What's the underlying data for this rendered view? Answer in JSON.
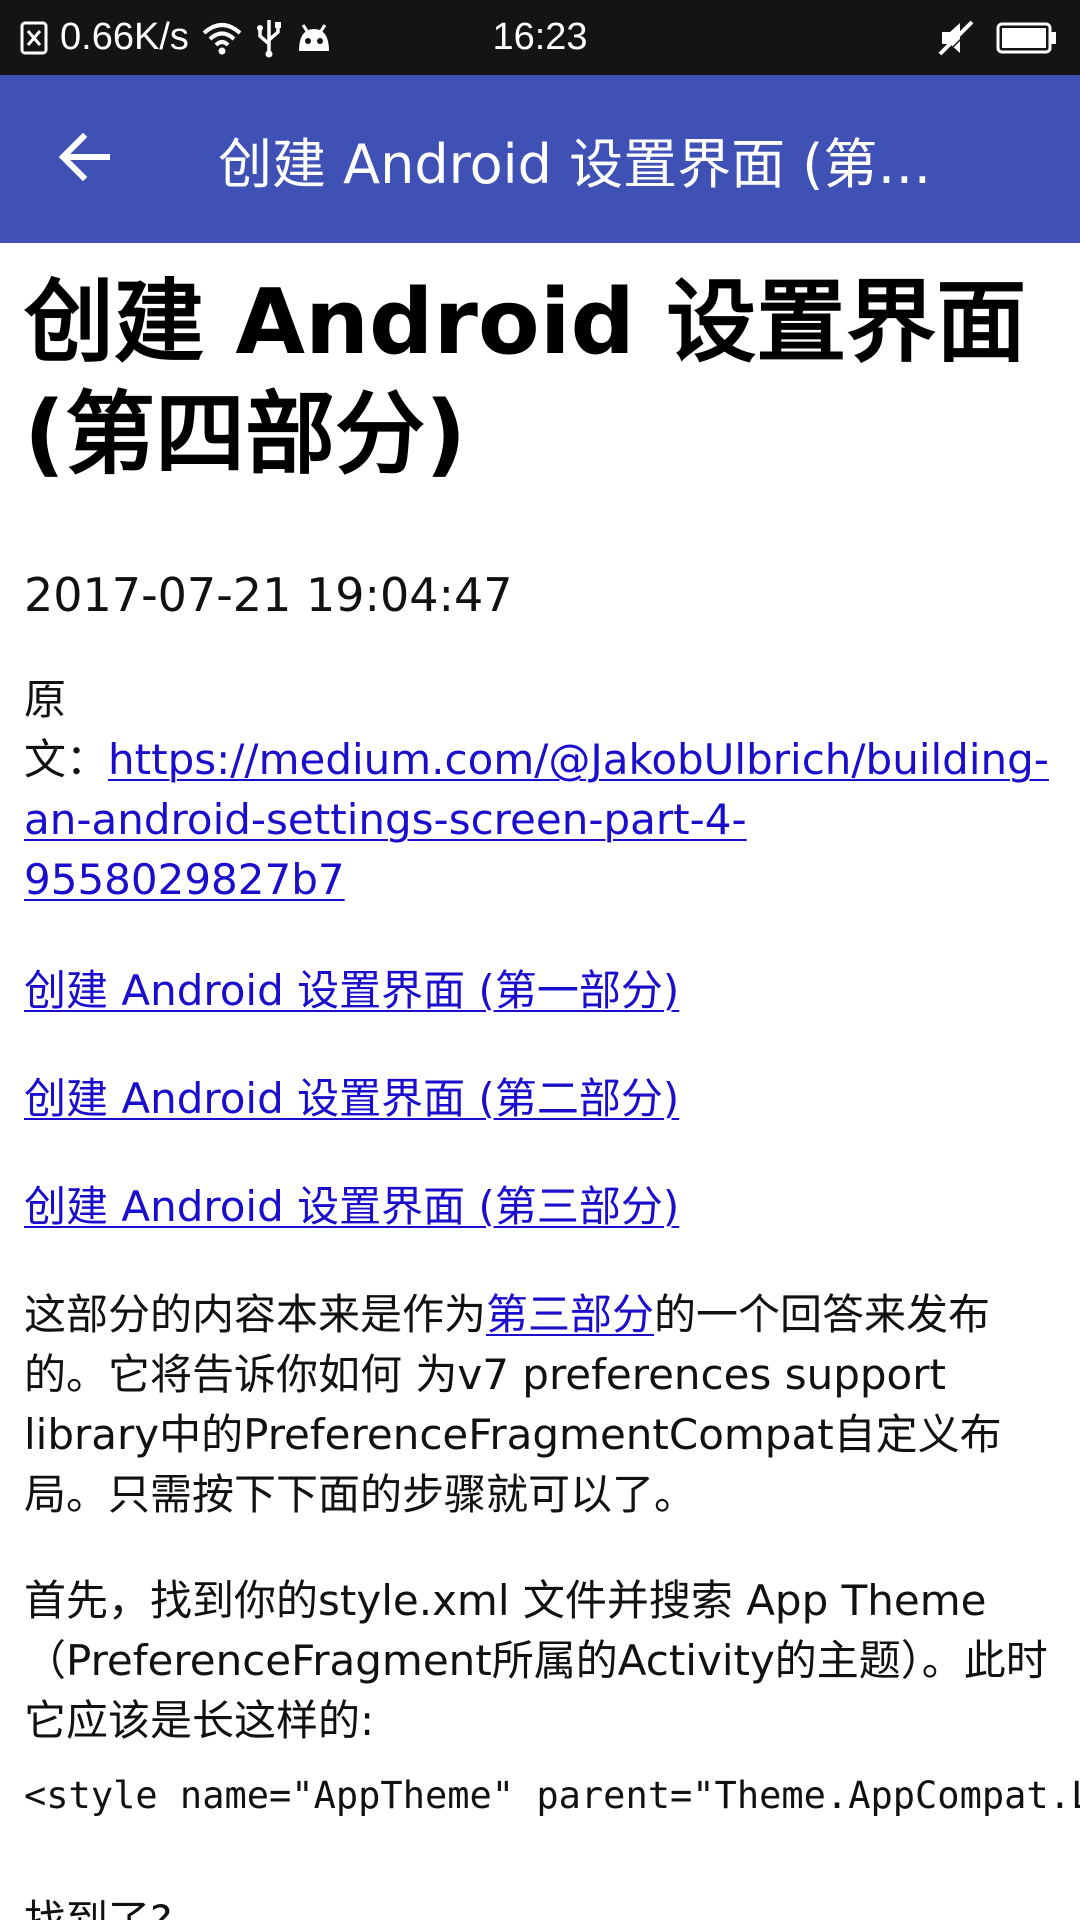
{
  "status_bar": {
    "speed": "0.66K/s",
    "time": "16:23",
    "icons": [
      "notification-icon",
      "wifi-icon",
      "usb-icon",
      "android-debug-icon",
      "mute-icon",
      "battery-icon"
    ]
  },
  "app_bar": {
    "title": "创建 Android 设置界面 (第…",
    "back_icon": "arrow-back-icon",
    "background": "#3F51B5"
  },
  "article": {
    "title": "创建 Android 设置界面 (第四部分)",
    "date": "2017-07-21 19:04:47",
    "source_label_line1": "原",
    "source_label_line2": "文：",
    "source_url_part1": "https://medium.com/@JakobUlbrich/building-",
    "source_url_part2": "an-android-settings-screen-part-4-",
    "source_url_part3": "9558029827b7",
    "series_links": [
      "创建 Android 设置界面 (第一部分)",
      "创建 Android 设置界面 (第二部分)",
      "创建 Android 设置界面 (第三部分)"
    ],
    "para1_before": "这部分的内容本来是作为",
    "para1_link": "第三部分",
    "para1_after": "的一个回答来发布的。它将告诉你如何 为v7 preferences support library中的PreferenceFragmentCompat自定义布局。只需按下下面的步骤就可以了。",
    "para2": "首先，找到你的style.xml 文件并搜索 App Theme（PreferenceFragment所属的Activity的主题）。此时它应该是长这样的:",
    "code_line": "<style name=\"AppTheme\" parent=\"Theme.AppCompat.Light.DarkActionBar\">",
    "next_text": "找到了?",
    "link_color": "#1a0dcc"
  }
}
